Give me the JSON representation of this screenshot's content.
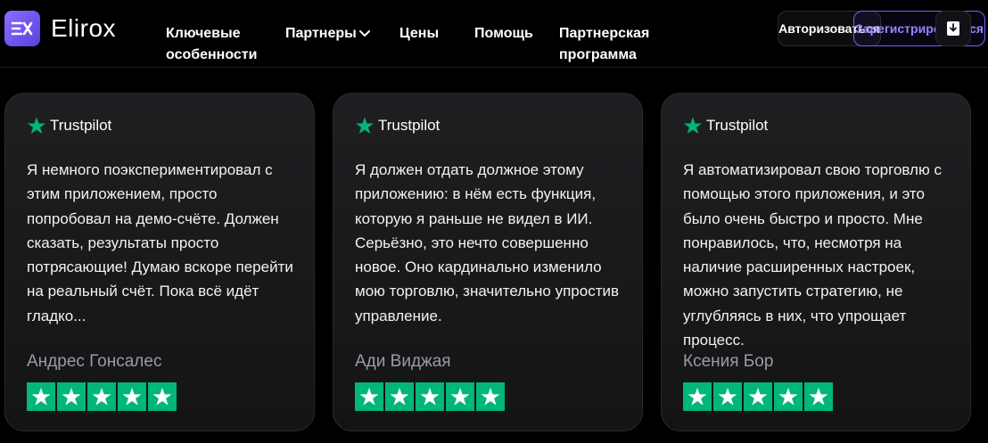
{
  "header": {
    "brand": "Elirox",
    "nav": [
      {
        "label": "Ключевые\nособенности"
      },
      {
        "label": "Партнеры"
      },
      {
        "label": "Цены"
      },
      {
        "label": "Помощь"
      },
      {
        "label": "Партнерская\nпрограмма"
      }
    ],
    "login_label": "Авторизоваться",
    "register_label": "Зарегистрироваться"
  },
  "reviews": [
    {
      "platform": "Trustpilot",
      "text": "Я немного поэкспериментировал с этим приложением, просто попробовал на демо-счёте. Должен сказать, результаты просто потрясающие! Думаю вскоре перейти на реальный счёт. Пока всё идёт гладко...",
      "author": "Андрес Гонсалес",
      "rating": 5
    },
    {
      "platform": "Trustpilot",
      "text": "Я должен отдать должное этому приложению: в нём есть функция, которую я раньше не видел в ИИ. Серьёзно, это нечто совершенно новое. Оно кардинально изменило мою торговлю, значительно упростив управление.",
      "author": "Ади Виджая",
      "rating": 5
    },
    {
      "platform": "Trustpilot",
      "text": "Я автоматизировал свою торговлю с помощью этого приложения, и это было очень быстро и просто. Мне понравилось, что, несмотря на наличие расширенных настроек, можно запустить стратегию, не углубляясь в них, что упрощает процесс.",
      "author": "Ксения Бор",
      "rating": 5
    }
  ],
  "colors": {
    "brand": "#6a4cf0",
    "trustpilot_green": "#00b67a",
    "register_accent": "#9b82ff"
  },
  "icons": [
    "logo-icon",
    "chevron-down-icon",
    "download-icon",
    "trustpilot-star-icon",
    "star-icon"
  ]
}
